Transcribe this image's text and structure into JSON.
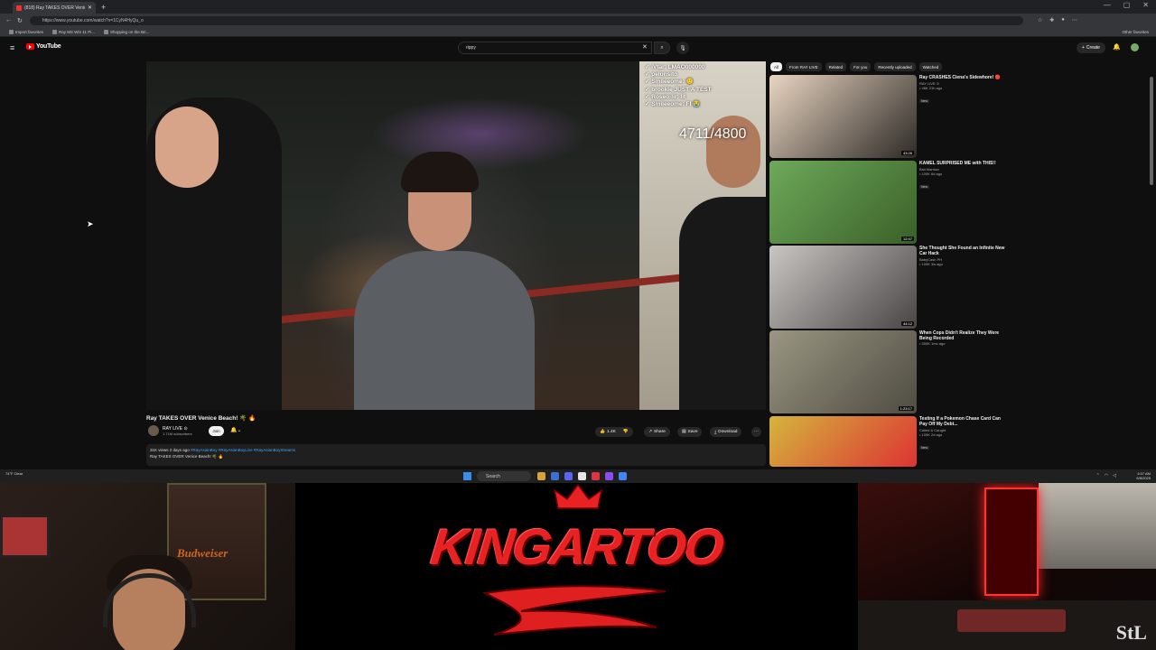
{
  "browser": {
    "tab_title": "(818) Ray TAKES OVER Venice",
    "url": "https://www.youtube.com/watch?v=1CyN4HyQu_o",
    "bookmarks": [
      "Import favorites",
      "Ray MS Win 11 Pi...",
      "Shopping on the Bri..."
    ],
    "other_favorites": "Other favorites",
    "tab_close": "✕",
    "new_tab": "+"
  },
  "youtube": {
    "logo_text": "YouTube",
    "search_value": "rippy",
    "create_label": "Create",
    "player": {
      "chat_lines": [
        "✓ iVtar: LMAO000000",
        "✓ pelonsito ",
        "✓ Smileeome: 🙂",
        "✓ brookie JUST A TEST",
        "✓ Roseo-lir: lit",
        "✓ Smileeome: FI 😭"
      ],
      "goal": "4711/4800"
    },
    "video_title": "Ray TAKES OVER Venice Beach! 🌴 🔥",
    "channel_name": "RAY LIVE ⊙",
    "channel_subs": "1.71M subscribers",
    "join_label": "Join",
    "like_count": "1.4K",
    "share_label": "Share",
    "save_label": "Save",
    "download_label": "Download",
    "description_meta": "31K views  2 days ago",
    "description_tags": "#RayAsianBoy #RayAsianBoyLive #RayAsianBoyStreams",
    "description_line": "Ray TAKES OVER Venice Beach! 🌴 🔥",
    "filters": [
      "All",
      "From RAY LIVE",
      "Related",
      "For you",
      "Recently uploaded",
      "Watched"
    ],
    "recommendations": [
      {
        "title": "Ray CRASHES Ciena's Sidewhore! 🔴",
        "channel": "RAY LIVE ⊙",
        "meta": "• 46K  21h ago",
        "badge": "New",
        "duration": "43:26",
        "colors": [
          "#e9d5c1",
          "#2d2a26"
        ]
      },
      {
        "title": "KAMEL SURPRISED ME with THIS!!",
        "channel": "Bali Mantow",
        "meta": "• 100K  6d ago",
        "badge": "New",
        "duration": "12:47",
        "colors": [
          "#6ea95a",
          "#3a6028"
        ]
      },
      {
        "title": "She Thought She Found an Infinite New Car Hack",
        "channel": "BabyCash PH",
        "meta": "• 100K  3w ago",
        "badge": "",
        "duration": "44:12",
        "colors": [
          "#c9c6c3",
          "#4a4545"
        ]
      },
      {
        "title": "When Cops Didn't Realize They Were Being Recorded",
        "channel": "",
        "meta": "• 300K  1mo ago",
        "badge": "",
        "duration": "1:23:17",
        "colors": [
          "#9a9682",
          "#4f4c42"
        ]
      },
      {
        "title": "Testing If a Pokemon Chase Card Can Pay Off My Debt...",
        "channel": "Called & Caught",
        "meta": "• 100K  2d ago",
        "badge": "New",
        "duration": "",
        "colors": [
          "#d4b53d",
          "#d33"
        ]
      }
    ]
  },
  "taskbar": {
    "weather": "74°F  Clear",
    "search_placeholder": "Search",
    "time": "4:07 AM",
    "date": "6/8/2025"
  },
  "overlay": {
    "brand_text": "KINGARTOO",
    "poster_text": "Budweiser",
    "corner_logo": "StL"
  }
}
